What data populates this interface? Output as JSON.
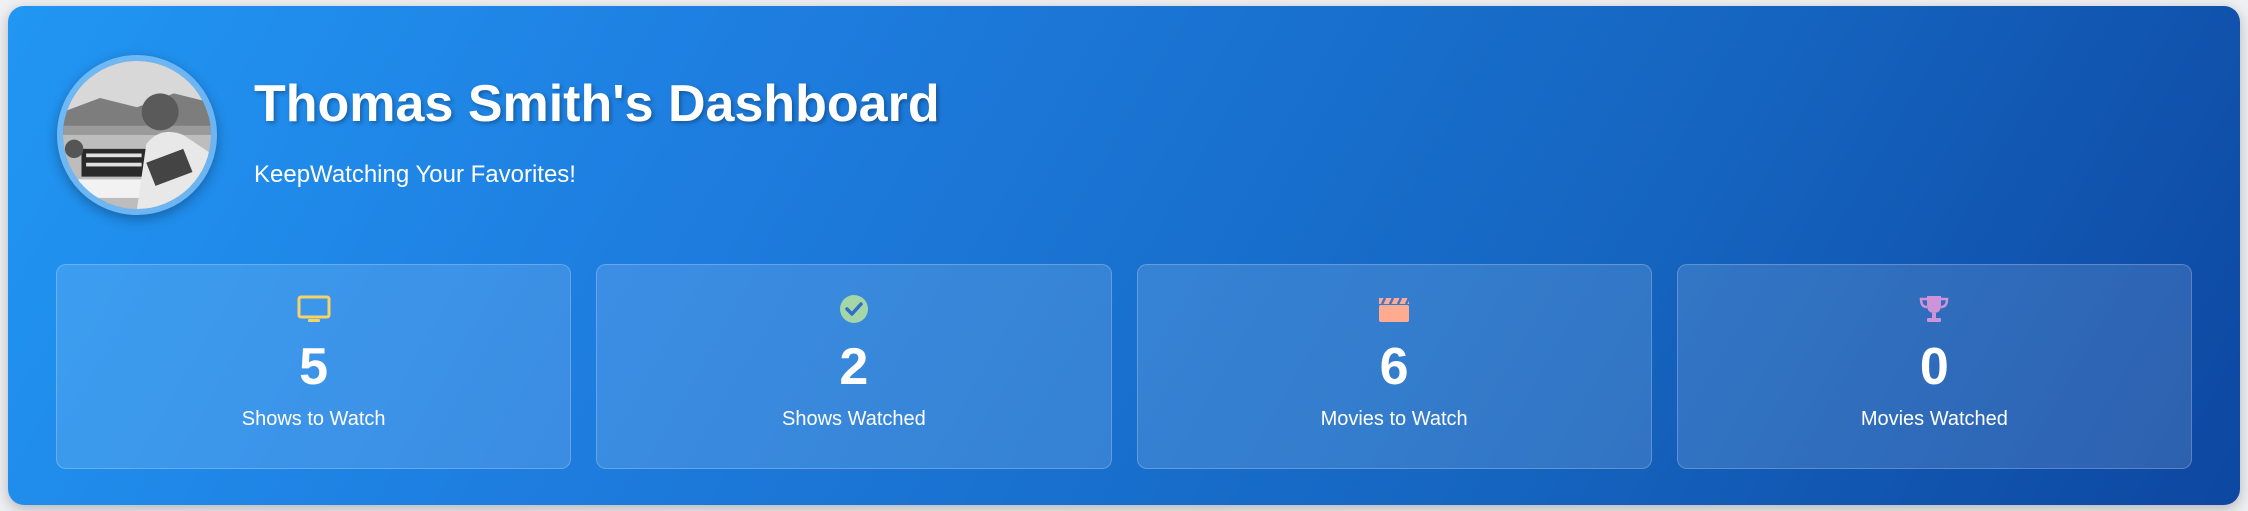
{
  "header": {
    "title": "Thomas Smith's Dashboard",
    "subtitle": "KeepWatching Your Favorites!"
  },
  "stats": [
    {
      "icon": "tv-icon",
      "value": "5",
      "label": "Shows to Watch",
      "icon_color": "#f6d365"
    },
    {
      "icon": "check-circle-icon",
      "value": "2",
      "label": "Shows Watched",
      "icon_color": "#a5d6a7"
    },
    {
      "icon": "clapperboard-icon",
      "value": "6",
      "label": "Movies to Watch",
      "icon_color": "#ffab91"
    },
    {
      "icon": "trophy-icon",
      "value": "0",
      "label": "Movies Watched",
      "icon_color": "#ce93d8"
    }
  ],
  "colors": {
    "gradient_start": "#2196f3",
    "gradient_end": "#0d47a1"
  }
}
